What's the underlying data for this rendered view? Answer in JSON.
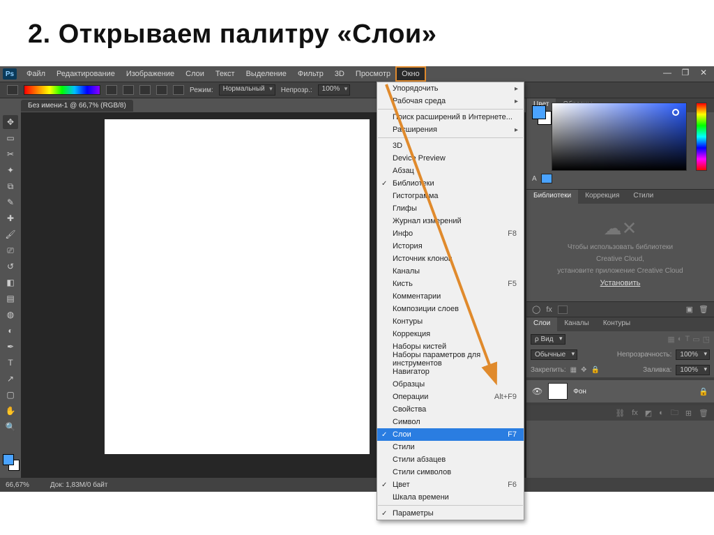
{
  "slide": {
    "title": "2. Открываем палитру «Слои»"
  },
  "menubar": {
    "logo": "Ps",
    "items": [
      "Файл",
      "Редактирование",
      "Изображение",
      "Слои",
      "Текст",
      "Выделение",
      "Фильтр",
      "3D",
      "Просмотр",
      "Окно"
    ],
    "selected_index": 9
  },
  "optionbar": {
    "mode_label": "Режим:",
    "mode_value": "Нормальный",
    "opacity_label": "Непрозр.:",
    "opacity_value": "100%"
  },
  "doc_tab": "Без имени-1 @ 66,7% (RGB/8)",
  "status": {
    "zoom": "66,67%",
    "doc": "Док: 1,83M/0 байт"
  },
  "window_menu": {
    "groups": [
      [
        {
          "label": "Упорядочить",
          "sub": true
        },
        {
          "label": "Рабочая среда",
          "sub": true
        }
      ],
      [
        {
          "label": "Поиск расширений в Интернете..."
        },
        {
          "label": "Расширения",
          "sub": true
        }
      ],
      [
        {
          "label": "3D"
        },
        {
          "label": "Device Preview"
        },
        {
          "label": "Абзац"
        },
        {
          "label": "Библиотеки",
          "checked": true
        },
        {
          "label": "Гистограмма"
        },
        {
          "label": "Глифы"
        },
        {
          "label": "Журнал измерений"
        },
        {
          "label": "Инфо",
          "shortcut": "F8"
        },
        {
          "label": "История"
        },
        {
          "label": "Источник клонов"
        },
        {
          "label": "Каналы"
        },
        {
          "label": "Кисть",
          "shortcut": "F5"
        },
        {
          "label": "Комментарии"
        },
        {
          "label": "Композиции слоев"
        },
        {
          "label": "Контуры"
        },
        {
          "label": "Коррекция"
        },
        {
          "label": "Наборы кистей"
        },
        {
          "label": "Наборы параметров для инструментов"
        },
        {
          "label": "Навигатор"
        },
        {
          "label": "Образцы"
        },
        {
          "label": "Операции",
          "shortcut": "Alt+F9"
        },
        {
          "label": "Свойства"
        },
        {
          "label": "Символ"
        },
        {
          "label": "Слои",
          "shortcut": "F7",
          "checked": true,
          "selected": true
        },
        {
          "label": "Стили"
        },
        {
          "label": "Стили абзацев"
        },
        {
          "label": "Стили символов"
        },
        {
          "label": "Цвет",
          "shortcut": "F6",
          "checked": true
        },
        {
          "label": "Шкала времени"
        }
      ],
      [
        {
          "label": "Параметры",
          "checked": true
        }
      ]
    ]
  },
  "color_panel": {
    "tabs": [
      "Цвет",
      "Образцы"
    ],
    "row2_letter": "A"
  },
  "libraries_panel": {
    "tabs": [
      "Библиотеки",
      "Коррекция",
      "Стили"
    ],
    "msg1": "Чтобы использовать библиотеки",
    "msg2": "Creative Cloud,",
    "msg3": "установите приложение Creative Cloud",
    "link": "Установить"
  },
  "layers_panel": {
    "tabs": [
      "Слои",
      "Каналы",
      "Контуры"
    ],
    "kind_label": "Вид",
    "blend_value": "Обычные",
    "opacity_label": "Непрозрачность:",
    "opacity_value": "100%",
    "lock_label": "Закрепить:",
    "fill_label": "Заливка:",
    "fill_value": "100%",
    "layer_name": "Фон"
  },
  "mid_strip": {
    "fx": "fx"
  }
}
